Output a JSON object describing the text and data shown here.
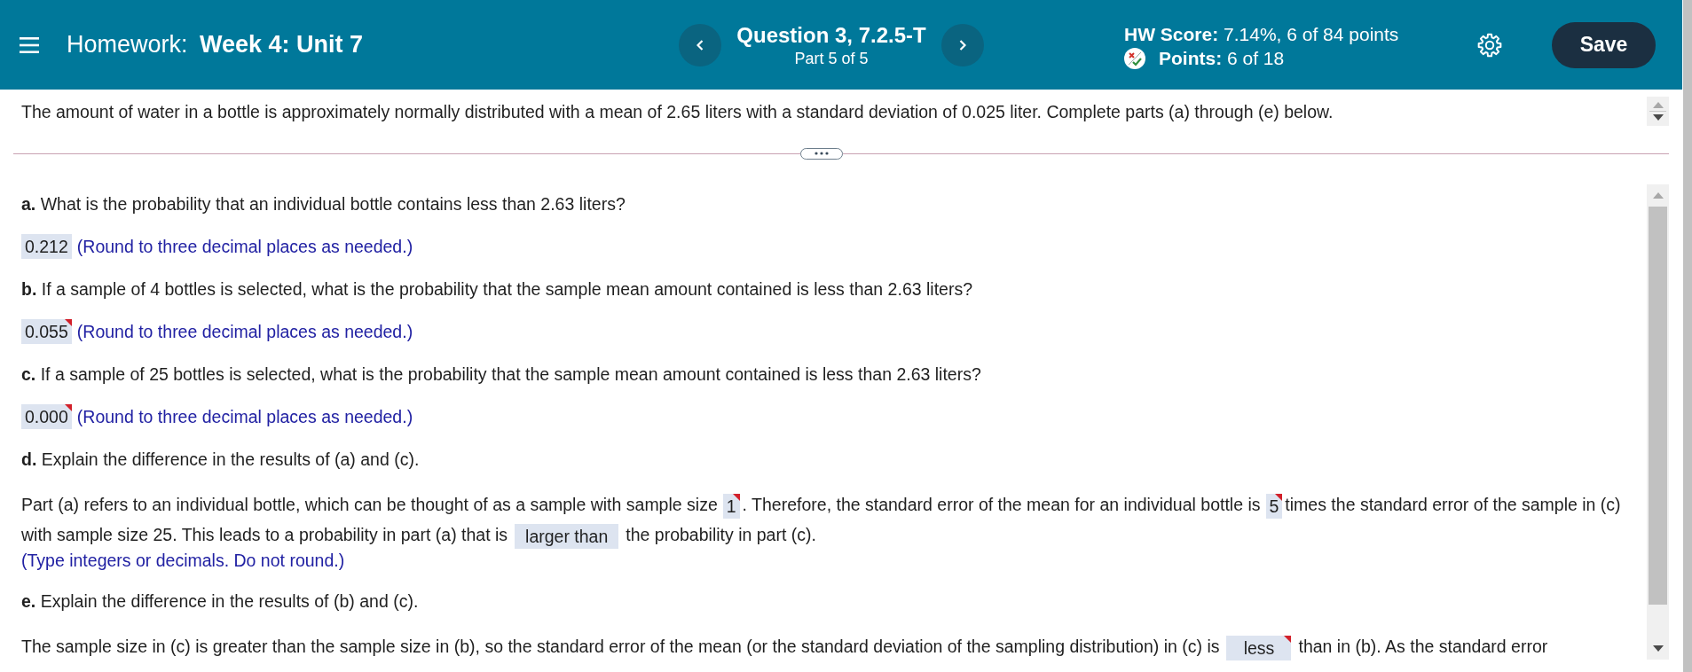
{
  "header": {
    "title": "Homework: **Week 4: Unit 7**",
    "question": "Question 3, 7.2.5-T",
    "part": "Part 5 of 5",
    "hw_score": "**HW Score:** 7.14%, 6 of 84 points",
    "points": "**Points:** 6 of 18",
    "save": "Save"
  },
  "problem": {
    "statement": "The amount of water in a bottle is approximately normally distributed with a mean of 2.65 liters with a standard deviation of 0.025 liter. Complete parts (a) through (e) below."
  },
  "parts": [
    {
      "kind": "single",
      "question": "**a.** What is the probability that an individual bottle contains less than 2.63 liters?",
      "answer": {
        "value": "0.212",
        "flagged": false
      },
      "hint": "(Round to three decimal places as needed.)"
    },
    {
      "kind": "single",
      "question": "**b.** If a sample of 4 bottles is selected, what is the probability that the sample mean amount contained is less than 2.63 liters?",
      "answer": {
        "value": "0.055",
        "flagged": true
      },
      "hint": "(Round to three decimal places as needed.)"
    },
    {
      "kind": "single",
      "question": "**c.** If a sample of 25 bottles is selected, what is the probability that the sample mean amount contained is less than 2.63 liters?",
      "answer": {
        "value": "0.000",
        "flagged": true
      },
      "hint": "(Round to three decimal places as needed.)"
    },
    {
      "kind": "fill",
      "question": "**d.** Explain the difference in the results of (a) and (c).",
      "segments": [
        {
          "kind": "text",
          "text": "Part (a) refers to an individual bottle, which can be thought of as a sample with sample size"
        },
        {
          "kind": "input",
          "value": "1",
          "flagged": true
        },
        {
          "kind": "text",
          "text": ". Therefore, the standard error of the mean for an individual bottle is"
        },
        {
          "kind": "input",
          "value": "5",
          "flagged": true
        },
        {
          "kind": "text",
          "text": "times the standard error of the sample in (c)"
        },
        {
          "kind": "text",
          "text": "with sample size 25. This leads to a probability in part (a) that is"
        },
        {
          "kind": "select",
          "value": "larger than",
          "flagged": false
        },
        {
          "kind": "text",
          "text": "the probability in part (c)."
        }
      ],
      "hint": "(Type integers or decimals. Do not round.)"
    },
    {
      "kind": "fill",
      "question": "**e.** Explain the difference in the results of (b) and (c).",
      "segments": [
        {
          "kind": "text",
          "text": "The sample size in (c) is greater than the sample size in (b), so the standard error of the mean (or the standard deviation of the sampling distribution) in (c) is"
        },
        {
          "kind": "select",
          "value": "less",
          "flagged": true
        },
        {
          "kind": "text",
          "text": "than in (b). As the standard error"
        }
      ]
    }
  ]
}
